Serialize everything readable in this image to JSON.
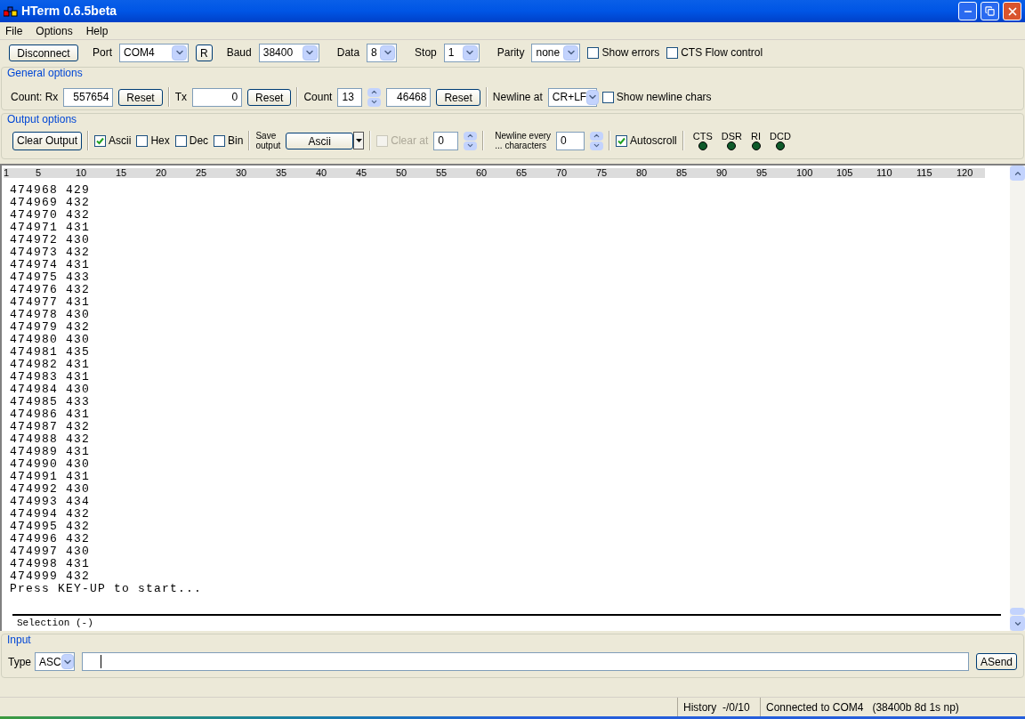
{
  "window": {
    "title": "HTerm 0.6.5beta"
  },
  "menu": [
    "File",
    "Options",
    "Help"
  ],
  "connection": {
    "connect_button": "Disconnect",
    "port": {
      "label": "Port",
      "value": "COM4"
    },
    "rescan_button": "R",
    "baud": {
      "label": "Baud",
      "value": "38400"
    },
    "data": {
      "label": "Data",
      "value": "8"
    },
    "stop": {
      "label": "Stop",
      "value": "1"
    },
    "parity": {
      "label": "Parity",
      "value": "none"
    },
    "options": [
      {
        "label": "Show errors",
        "checked": false
      },
      {
        "label": "CTS Flow control",
        "checked": false
      }
    ]
  },
  "general_options": {
    "title": "General options",
    "rx": {
      "label": "Count: Rx",
      "value": "557654",
      "reset": "Reset"
    },
    "tx": {
      "label": "Tx",
      "value": "0",
      "reset": "Reset"
    },
    "count": {
      "label": "Count",
      "value": "13",
      "total": "46468",
      "reset": "Reset"
    },
    "newline": {
      "label": "Newline at",
      "value": "CR+LF"
    },
    "show_newline": {
      "label": "Show newline chars",
      "checked": false
    }
  },
  "output_options": {
    "title": "Output options",
    "clear_button": "Clear Output",
    "formats": [
      {
        "label": "Ascii",
        "checked": true
      },
      {
        "label": "Hex",
        "checked": false
      },
      {
        "label": "Dec",
        "checked": false
      },
      {
        "label": "Bin",
        "checked": false
      }
    ],
    "save": {
      "label_lines": [
        "Save",
        "output"
      ],
      "value": "Ascii"
    },
    "clear_at": {
      "label": "Clear at",
      "value": "0",
      "checked": false,
      "disabled": true
    },
    "newline_every": {
      "label_lines": [
        "Newline every",
        "... characters"
      ],
      "value": "0"
    },
    "autoscroll": {
      "label": "Autoscroll",
      "checked": true
    },
    "signals": [
      {
        "label": "CTS",
        "on": false
      },
      {
        "label": "DSR",
        "on": false
      },
      {
        "label": "RI",
        "on": false
      },
      {
        "label": "DCD",
        "on": false
      }
    ]
  },
  "terminal": {
    "ruler": [
      "1",
      "5",
      "10",
      "15",
      "20",
      "25",
      "30",
      "35",
      "40",
      "45",
      "50",
      "55",
      "60",
      "65",
      "70",
      "75",
      "80",
      "85",
      "90",
      "95",
      "100",
      "105",
      "110",
      "115",
      "120"
    ],
    "lines": [
      "474968 429",
      "474969 432",
      "474970 432",
      "474971 431",
      "474972 430",
      "474973 432",
      "474974 431",
      "474975 433",
      "474976 432",
      "474977 431",
      "474978 430",
      "474979 432",
      "474980 430",
      "474981 435",
      "474982 431",
      "474983 431",
      "474984 430",
      "474985 433",
      "474986 431",
      "474987 432",
      "474988 432",
      "474989 431",
      "474990 430",
      "474991 431",
      "474992 430",
      "474993 434",
      "474994 432",
      "474995 432",
      "474996 432",
      "474997 430",
      "474998 431",
      "474999 432",
      "Press KEY-UP to start..."
    ],
    "selection": "Selection (-)"
  },
  "input": {
    "title": "Input",
    "type_label": "Type",
    "type_value": "ASC",
    "send_button": "ASend"
  },
  "status_bar": [
    "History  -/0/10",
    "Connected to COM4   (38400b 8d 1s np)"
  ]
}
